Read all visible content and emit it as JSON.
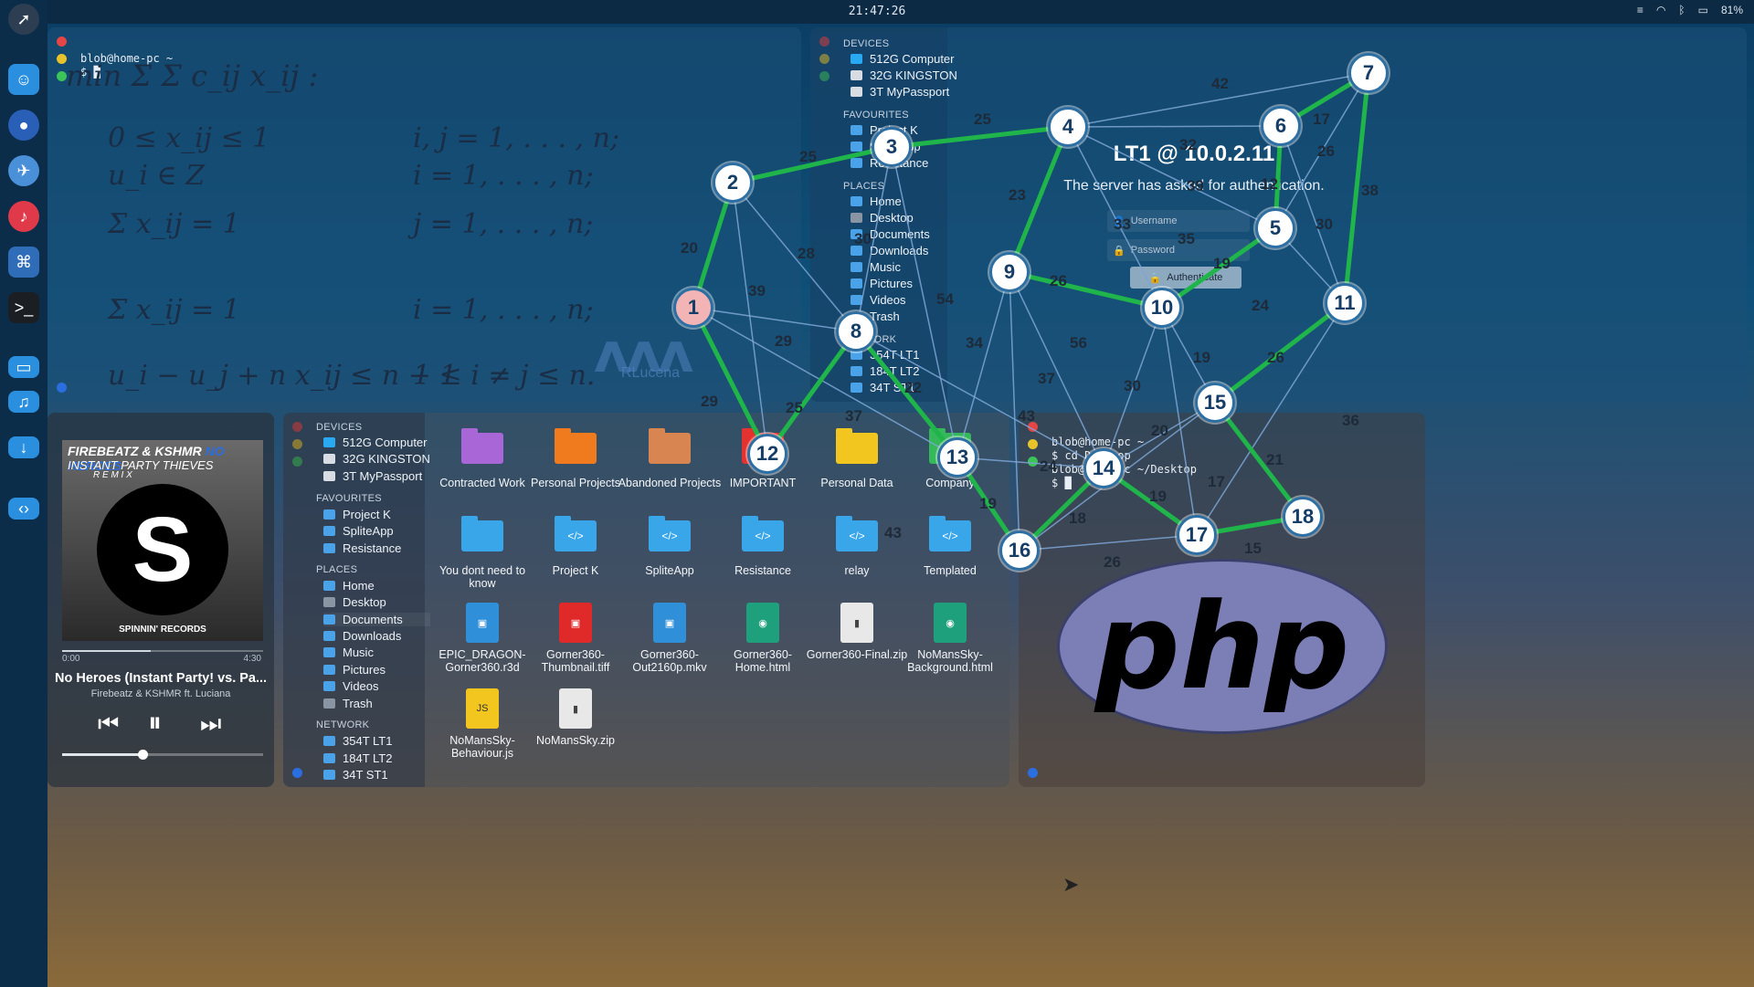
{
  "topbar": {
    "clock": "21:47:26",
    "battery": "81%"
  },
  "dock": {
    "icons": [
      "rocket-icon",
      "finder-icon",
      "firefox-icon",
      "mail-icon",
      "music-icon",
      "code-icon",
      "terminal-icon",
      "folder-icon",
      "music-folder-icon",
      "download-folder-icon",
      "code-folder-icon"
    ]
  },
  "term1": {
    "prompt_line": "blob@home-pc ~",
    "cursor_line": "$ █"
  },
  "math": {
    "l1": "min Σ Σ c_ij x_ij :",
    "l2a": "0 ≤ x_ij ≤ 1",
    "l2b": "i, j = 1, . . . , n;",
    "l3a": "u_i ∈ Z",
    "l3b": "i = 1, . . . , n;",
    "l4a": "Σ x_ij = 1",
    "l4b": "j = 1, . . . , n;",
    "l5a": "Σ x_ij = 1",
    "l5b": "i = 1, . . . , n;",
    "l6a": "u_i − u_j + n x_ij ≤ n − 1",
    "l6b": "1 ≤ i ≠ j ≤ n."
  },
  "fm_small": {
    "devices_title": "DEVICES",
    "devices": [
      "512G Computer",
      "32G KINGSTON",
      "3T MyPassport"
    ],
    "fav_title": "FAVOURITES",
    "favs": [
      "Project K",
      "SpliteApp",
      "Resistance"
    ],
    "places_title": "PLACES",
    "places": [
      "Home",
      "Desktop",
      "Documents",
      "Downloads",
      "Music",
      "Pictures",
      "Videos",
      "Trash"
    ],
    "network_title": "NETWORK",
    "network": [
      "354T LT1",
      "184T LT2",
      "34T ST1"
    ]
  },
  "auth": {
    "title": "LT1 @ 10.0.2.11",
    "message": "The server has asked for authentication.",
    "username_placeholder": "Username",
    "password_placeholder": "Password",
    "button": "Authenticate"
  },
  "player": {
    "art_artist": "FIREBEATZ & KSHMR",
    "art_title": "NO HEROES",
    "art_sub": "INSTANT PARTY THIEVES",
    "art_remix": "R E M I X",
    "art_label": "SPINNIN' RECORDS",
    "time_elapsed": "0:00",
    "time_total": "4:30",
    "progress": 0.44,
    "volume": 0.4,
    "song": "No Heroes (Instant Party! vs. Pa...",
    "artist": "Firebeatz & KSHMR ft. Luciana"
  },
  "fm_main": {
    "devices_title": "DEVICES",
    "devices": [
      "512G Computer",
      "32G KINGSTON",
      "3T MyPassport"
    ],
    "fav_title": "FAVOURITES",
    "favs": [
      "Project K",
      "SpliteApp",
      "Resistance"
    ],
    "places_title": "PLACES",
    "places": [
      "Home",
      "Desktop",
      "Documents",
      "Downloads",
      "Music",
      "Pictures",
      "Videos",
      "Trash"
    ],
    "network_title": "NETWORK",
    "network": [
      "354T LT1",
      "184T LT2",
      "34T ST1"
    ],
    "files": [
      {
        "name": "Contracted Work",
        "kind": "folder",
        "color": "#a866d6"
      },
      {
        "name": "Personal Projects",
        "kind": "folder",
        "color": "#f07a1e"
      },
      {
        "name": "Abandoned Projects",
        "kind": "folder",
        "color": "#d98552"
      },
      {
        "name": "IMPORTANT",
        "kind": "folder",
        "color": "#e3322f"
      },
      {
        "name": "Personal Data",
        "kind": "folder",
        "color": "#f2c61f"
      },
      {
        "name": "Company",
        "kind": "folder",
        "color": "#35b85a"
      },
      {
        "name": "You dont need to know",
        "kind": "folder",
        "color": "#3aa6ea"
      },
      {
        "name": "Project K",
        "kind": "code-folder",
        "color": "#3aa6ea"
      },
      {
        "name": "SpliteApp",
        "kind": "code-folder",
        "color": "#3aa6ea"
      },
      {
        "name": "Resistance",
        "kind": "code-folder",
        "color": "#3aa6ea"
      },
      {
        "name": "relay",
        "kind": "code-folder",
        "color": "#3aa6ea"
      },
      {
        "name": "Templated",
        "kind": "code-folder",
        "color": "#3aa6ea"
      },
      {
        "name": "EPIC_DRAGON-Gorner360.r3d",
        "kind": "doc",
        "color": "#2f8fd8",
        "tag": "video"
      },
      {
        "name": "Gorner360-Thumbnail.tiff",
        "kind": "doc",
        "color": "#e02a2a",
        "tag": "tiff"
      },
      {
        "name": "Gorner360-Out2160p.mkv",
        "kind": "doc",
        "color": "#2f8fd8",
        "tag": "video"
      },
      {
        "name": "Gorner360-Home.html",
        "kind": "doc",
        "color": "#1ea07c",
        "tag": "web"
      },
      {
        "name": "Gorner360-Final.zip",
        "kind": "doc",
        "color": "#e8e8e8",
        "tag": "archive"
      },
      {
        "name": "NoMansSky-Background.html",
        "kind": "doc",
        "color": "#1ea07c",
        "tag": "web"
      },
      {
        "name": "NoMansSky-Behaviour.js",
        "kind": "doc",
        "color": "#f2c61f",
        "tag": "javascript"
      },
      {
        "name": "NoMansSky.zip",
        "kind": "doc",
        "color": "#e8e8e8",
        "tag": "archive"
      }
    ]
  },
  "term2": {
    "l1": "blob@home-pc ~",
    "l2": "$ cd Desktop",
    "l3": "blob@home-pc ~/Desktop",
    "l4": "$ █"
  },
  "php_logo": "php",
  "watermark": {
    "name": "RLucena"
  },
  "graph": {
    "nodes": [
      {
        "id": "1"
      },
      {
        "id": "2"
      },
      {
        "id": "3"
      },
      {
        "id": "4"
      },
      {
        "id": "5"
      },
      {
        "id": "6"
      },
      {
        "id": "7"
      },
      {
        "id": "8"
      },
      {
        "id": "9"
      },
      {
        "id": "10"
      },
      {
        "id": "11"
      },
      {
        "id": "12"
      },
      {
        "id": "13"
      },
      {
        "id": "14"
      },
      {
        "id": "15"
      },
      {
        "id": "16"
      },
      {
        "id": "17"
      },
      {
        "id": "18"
      }
    ],
    "tour_edges": [
      [
        "1",
        "2"
      ],
      [
        "2",
        "3"
      ],
      [
        "3",
        "4"
      ],
      [
        "4",
        "9"
      ],
      [
        "9",
        "10"
      ],
      [
        "10",
        "5"
      ],
      [
        "5",
        "6"
      ],
      [
        "6",
        "7"
      ],
      [
        "7",
        "11"
      ],
      [
        "11",
        "15"
      ],
      [
        "15",
        "18"
      ],
      [
        "18",
        "17"
      ],
      [
        "17",
        "14"
      ],
      [
        "14",
        "16"
      ],
      [
        "16",
        "13"
      ],
      [
        "13",
        "8"
      ],
      [
        "8",
        "12"
      ],
      [
        "12",
        "1"
      ]
    ],
    "labels": [
      "42",
      "17",
      "25",
      "32",
      "26",
      "25",
      "12",
      "23",
      "39",
      "38",
      "30",
      "20",
      "28",
      "35",
      "33",
      "30",
      "19",
      "39",
      "29",
      "26",
      "24",
      "54",
      "34",
      "56",
      "19",
      "26",
      "37",
      "30",
      "29",
      "25",
      "22",
      "37",
      "43",
      "36",
      "20",
      "21",
      "24",
      "19",
      "18",
      "17",
      "19",
      "43",
      "15",
      "26"
    ]
  }
}
